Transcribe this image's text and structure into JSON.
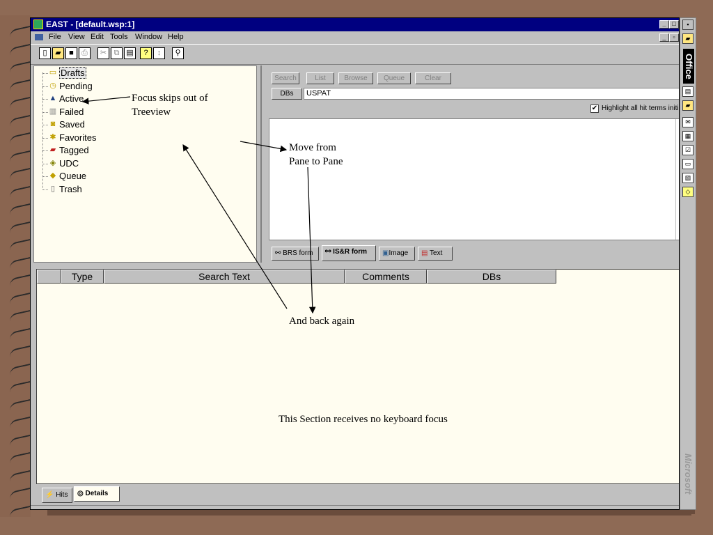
{
  "window": {
    "title": "EAST - [default.wsp:1]",
    "menus": [
      "File",
      "View",
      "Edit",
      "Tools",
      "Window",
      "Help"
    ]
  },
  "tree": {
    "items": [
      {
        "label": "Drafts",
        "icon": "drafts-icon"
      },
      {
        "label": "Pending",
        "icon": "pending-icon"
      },
      {
        "label": "Active",
        "icon": "active-icon"
      },
      {
        "label": "Failed",
        "icon": "failed-icon"
      },
      {
        "label": "Saved",
        "icon": "saved-icon"
      },
      {
        "label": "Favorites",
        "icon": "favorites-icon"
      },
      {
        "label": "Tagged",
        "icon": "tagged-icon"
      },
      {
        "label": "UDC",
        "icon": "udc-icon"
      },
      {
        "label": "Queue",
        "icon": "queue-icon"
      },
      {
        "label": "Trash",
        "icon": "trash-icon"
      }
    ]
  },
  "search_pane": {
    "buttons": [
      "Search",
      "List",
      "Browse",
      "Queue",
      "Clear"
    ],
    "dbs_label": "DBs",
    "dbs_value": "USPAT",
    "highlight_label": "Highlight all hit terms initial",
    "highlight_checked": true,
    "tabs": [
      "BRS form",
      "IS&R form",
      "Image",
      "Text"
    ]
  },
  "grid": {
    "columns": [
      "Type",
      "Search Text",
      "Comments",
      "DBs"
    ],
    "tabs": [
      "Hits",
      "Details"
    ]
  },
  "office_bar": {
    "label": "Office",
    "brand": "Microsoft"
  },
  "annotations": {
    "focus_skips": [
      "Focus skips out of",
      "Treeview"
    ],
    "move_from": [
      "Move from",
      "Pane to Pane"
    ],
    "back_again": "And back again",
    "no_focus": "This Section receives no keyboard focus"
  },
  "colors": {
    "titlebar": "#000080",
    "pane_bg": "#FFFDF0",
    "chrome": "#C0C0C0",
    "slide_bg": "#8E6A55"
  }
}
